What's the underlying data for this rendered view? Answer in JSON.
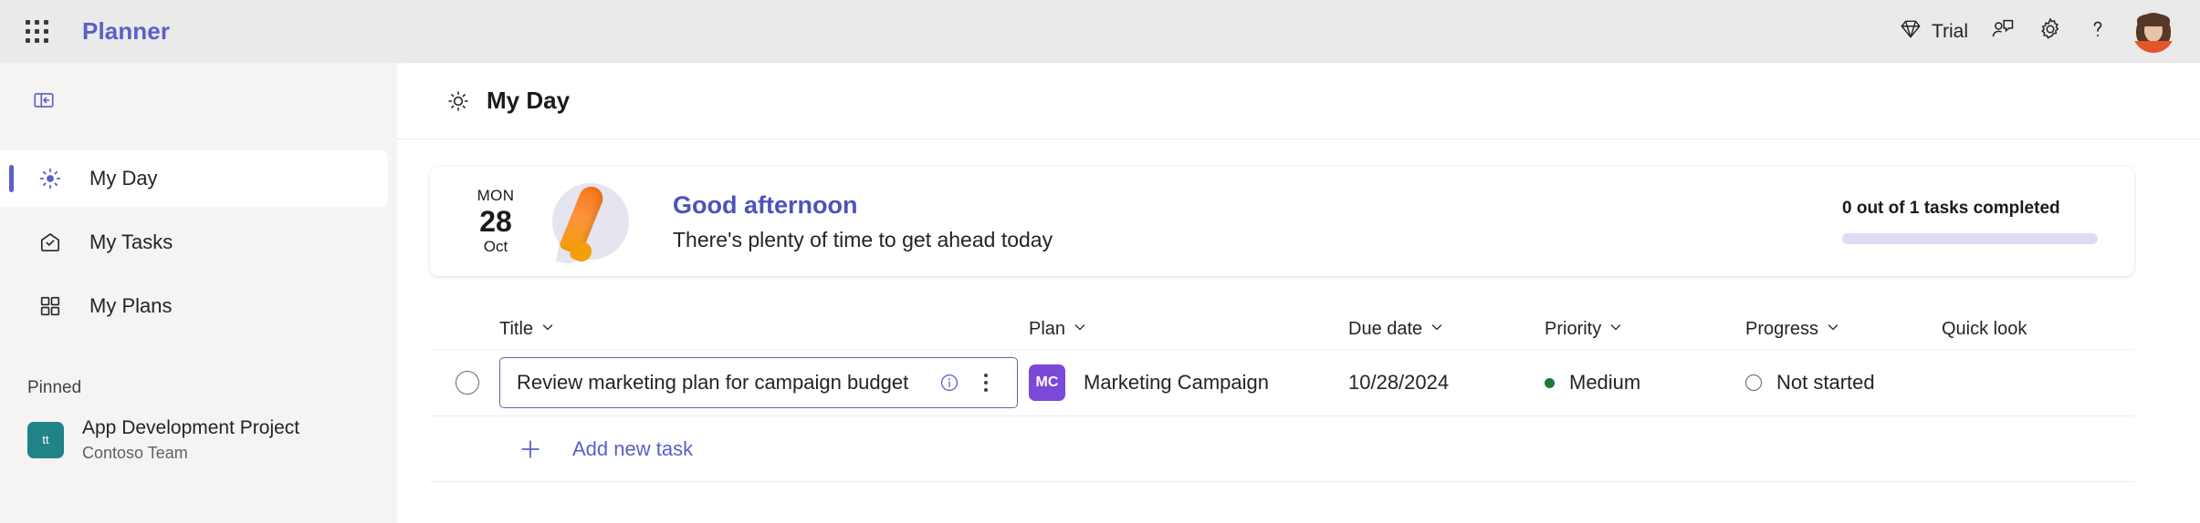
{
  "topbar": {
    "waffle_name": "app-launcher",
    "app_title": "Planner",
    "trial_label": "Trial",
    "icons": {
      "diamond": "diamond-icon",
      "feedback": "feedback-icon",
      "settings": "gear-icon",
      "help": "question-mark-icon",
      "avatar": "user-avatar"
    }
  },
  "sidebar": {
    "collapse_icon": "panel-collapse-icon",
    "items": [
      {
        "label": "My Day",
        "icon": "sun-icon",
        "active": true
      },
      {
        "label": "My Tasks",
        "icon": "tasks-envelope-icon",
        "active": false
      },
      {
        "label": "My Plans",
        "icon": "grid-squares-icon",
        "active": false
      }
    ],
    "pinned_header": "Pinned",
    "pinned": [
      {
        "title": "App Development Project",
        "subtitle": "Contoso Team",
        "initials": "tt",
        "color": "#218387"
      }
    ]
  },
  "page": {
    "title": "My Day",
    "title_icon": "sun-icon"
  },
  "greeting": {
    "date": {
      "weekday": "MON",
      "day": "28",
      "month": "Oct"
    },
    "title": "Good afternoon",
    "subtitle": "There's plenty of time to get ahead today",
    "progress_label": "0 out of 1 tasks completed",
    "progress_percent": 0,
    "progress_color": "#5b5fc7",
    "progress_track_color": "#dcdcf5"
  },
  "table": {
    "headers": {
      "title": "Title",
      "plan": "Plan",
      "due_date": "Due date",
      "priority": "Priority",
      "progress": "Progress",
      "quick_look": "Quick look"
    },
    "rows": [
      {
        "title": "Review marketing plan for campaign budget",
        "plan": "Marketing Campaign",
        "plan_initials": "MC",
        "plan_color": "#7b48d8",
        "due_date": "10/28/2024",
        "priority": "Medium",
        "priority_color": "#1d7a34",
        "progress": "Not started",
        "completed": false
      }
    ],
    "add_task_label": "Add new task"
  },
  "colors": {
    "brand_purple": "#5b5fc7",
    "topbar_bg": "#eaeaea",
    "sidebar_bg": "#f5f4f3",
    "content_bg": "#ffffff"
  }
}
